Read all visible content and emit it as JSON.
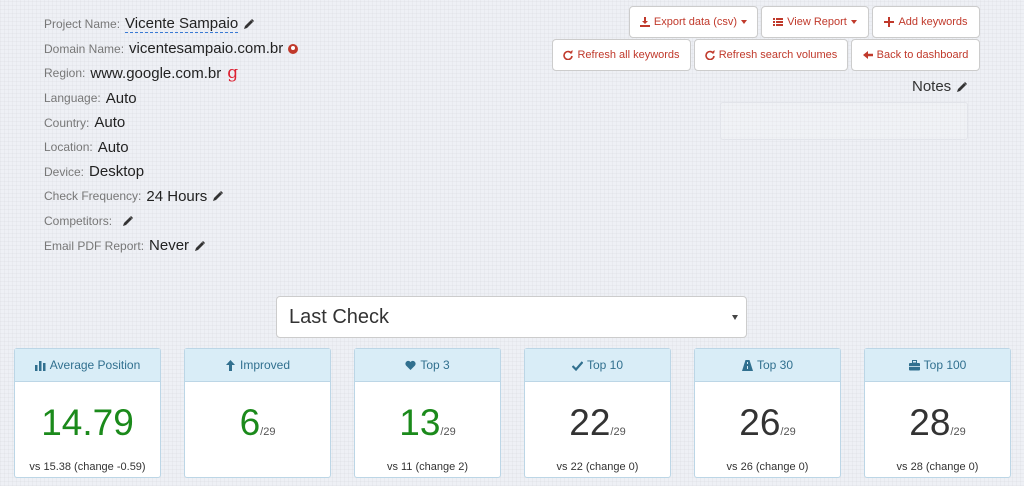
{
  "project": {
    "rows": [
      {
        "label": "Project Name:",
        "value": "Vicente Sampaio"
      },
      {
        "label": "Domain Name:",
        "value": "vicentesampaio.com.br"
      },
      {
        "label": "Region:",
        "value": "www.google.com.br"
      },
      {
        "label": "Language:",
        "value": "Auto"
      },
      {
        "label": "Country:",
        "value": "Auto"
      },
      {
        "label": "Location:",
        "value": "Auto"
      },
      {
        "label": "Device:",
        "value": "Desktop"
      },
      {
        "label": "Check Frequency:",
        "value": "24 Hours"
      },
      {
        "label": "Competitors:",
        "value": ""
      },
      {
        "label": "Email PDF Report:",
        "value": "Never"
      }
    ]
  },
  "toolbar": {
    "export": "Export data (csv)",
    "view_report": "View Report",
    "add_keywords": "Add keywords",
    "refresh_all": "Refresh all keywords",
    "refresh_volumes": "Refresh search volumes",
    "back": "Back to dashboard"
  },
  "notes": {
    "label": "Notes"
  },
  "period_select": {
    "value": "Last Check"
  },
  "colors": {
    "accent": "#c0392b",
    "panel_head": "#d9edf7",
    "positive": "#1b8a1b"
  },
  "cards": [
    {
      "title": "Average Position",
      "icon": "bar-chart-icon",
      "value": "14.79",
      "total": "",
      "foot": "vs 15.38 (change -0.59)"
    },
    {
      "title": "Improved",
      "icon": "arrow-up-icon",
      "value": "6",
      "total": "/29",
      "foot": ""
    },
    {
      "title": "Top 3",
      "icon": "heart-icon",
      "value": "13",
      "total": "/29",
      "foot": "vs 11 (change 2)"
    },
    {
      "title": "Top 10",
      "icon": "check-icon",
      "value": "22",
      "total": "/29",
      "foot": "vs 22 (change 0)"
    },
    {
      "title": "Top 30",
      "icon": "road-icon",
      "value": "26",
      "total": "/29",
      "foot": "vs 26 (change 0)"
    },
    {
      "title": "Top 100",
      "icon": "briefcase-icon",
      "value": "28",
      "total": "/29",
      "foot": "vs 28 (change 0)"
    }
  ]
}
